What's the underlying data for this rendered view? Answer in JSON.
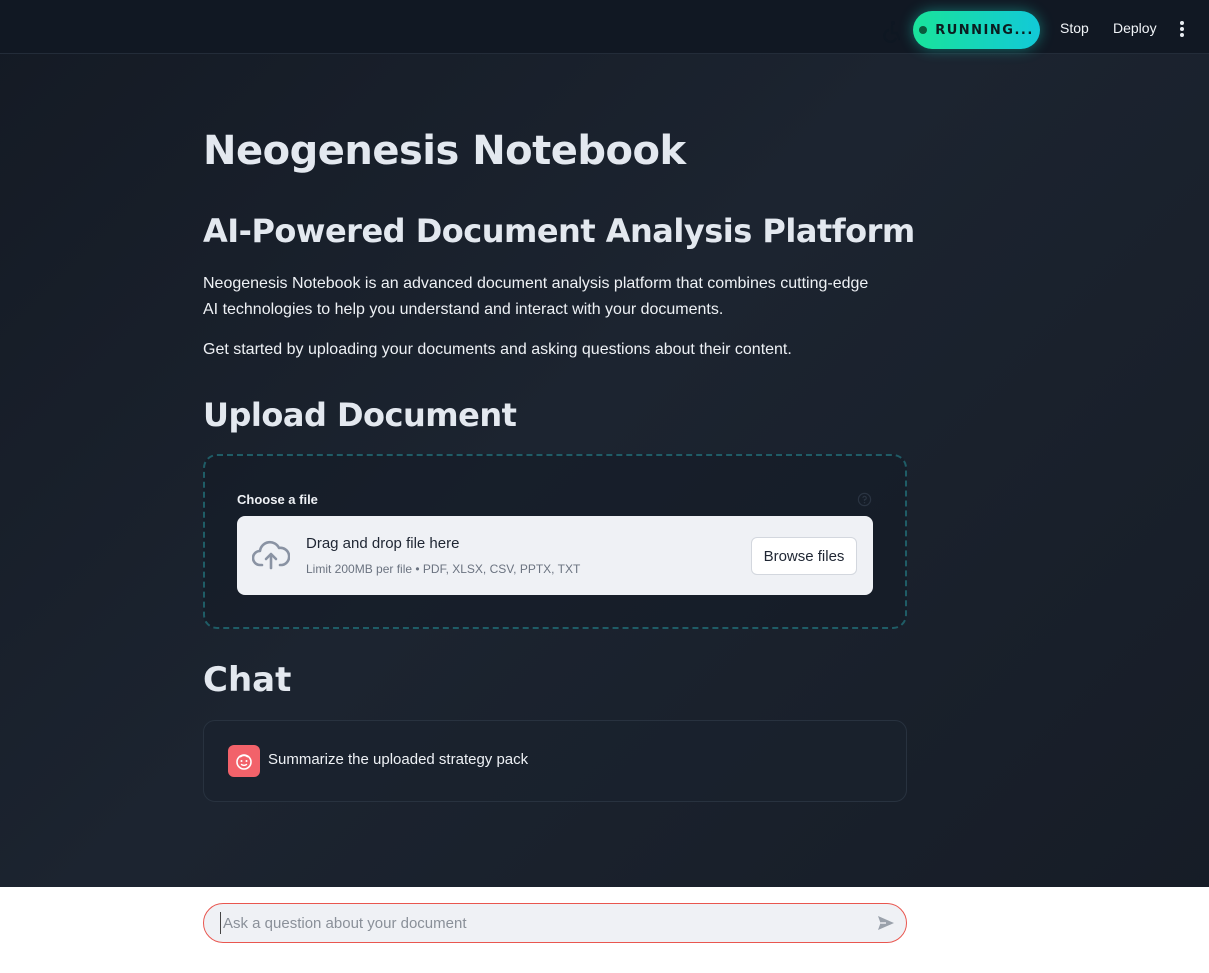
{
  "header": {
    "status_label": "RUNNING...",
    "stop_label": "Stop",
    "deploy_label": "Deploy",
    "accent_gradient": [
      "#19e39a",
      "#12c9d8"
    ]
  },
  "main": {
    "title": "Neogenesis Notebook",
    "subtitle": "AI-Powered Document Analysis Platform",
    "intro": "Neogenesis Notebook is an advanced document analysis platform that combines cutting-edge AI technologies to help you understand and interact with your documents.",
    "intro2": "Get started by uploading your documents and asking questions about their content."
  },
  "upload": {
    "heading": "Upload Document",
    "label": "Choose a file",
    "drop_title": "Drag and drop file here",
    "drop_limit": "Limit 200MB per file • PDF, XLSX, CSV, PPTX, TXT",
    "browse_label": "Browse files"
  },
  "chat": {
    "heading": "Chat",
    "messages": [
      {
        "role": "user",
        "avatar_icon": "user-face-icon",
        "text": "Summarize the uploaded strategy pack"
      }
    ],
    "input_placeholder": "Ask a question about your document",
    "input_value": ""
  },
  "icons": {
    "accessibility": "accessibility-icon",
    "menu": "kebab-menu-icon",
    "help": "help-icon",
    "upload": "cloud-upload-icon",
    "send": "send-icon"
  }
}
